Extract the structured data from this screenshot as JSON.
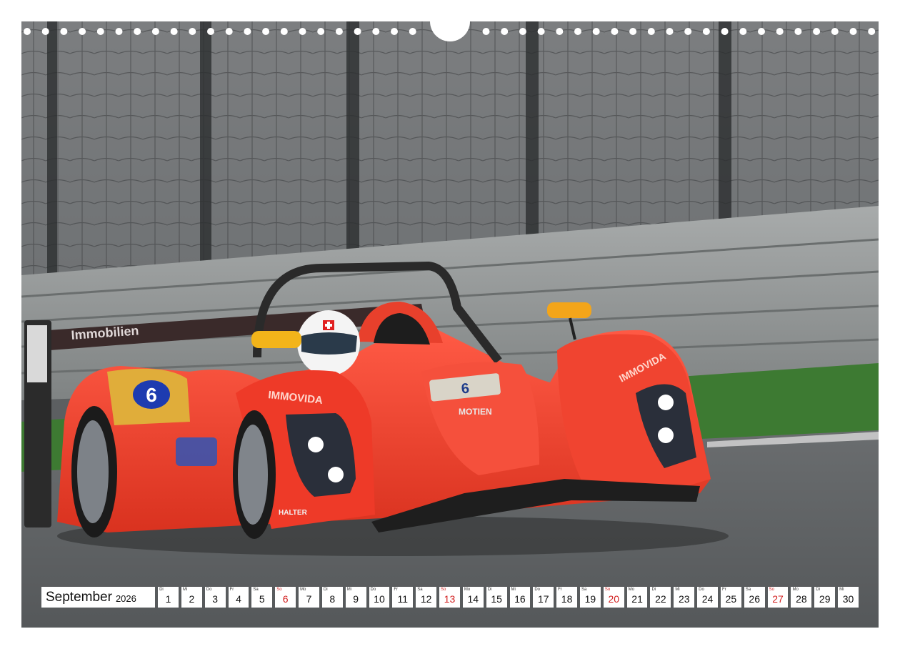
{
  "calendar": {
    "month": "September",
    "year": "2026",
    "days": [
      {
        "wd": "Di",
        "d": "1"
      },
      {
        "wd": "Mi",
        "d": "2"
      },
      {
        "wd": "Do",
        "d": "3"
      },
      {
        "wd": "Fr",
        "d": "4"
      },
      {
        "wd": "Sa",
        "d": "5"
      },
      {
        "wd": "So",
        "d": "6",
        "sun": true
      },
      {
        "wd": "Mo",
        "d": "7"
      },
      {
        "wd": "Di",
        "d": "8"
      },
      {
        "wd": "Mi",
        "d": "9"
      },
      {
        "wd": "Do",
        "d": "10"
      },
      {
        "wd": "Fr",
        "d": "11"
      },
      {
        "wd": "Sa",
        "d": "12"
      },
      {
        "wd": "So",
        "d": "13",
        "sun": true
      },
      {
        "wd": "Mo",
        "d": "14"
      },
      {
        "wd": "Di",
        "d": "15"
      },
      {
        "wd": "Mi",
        "d": "16"
      },
      {
        "wd": "Do",
        "d": "17"
      },
      {
        "wd": "Fr",
        "d": "18"
      },
      {
        "wd": "Sa",
        "d": "19"
      },
      {
        "wd": "So",
        "d": "20",
        "sun": true
      },
      {
        "wd": "Mo",
        "d": "21"
      },
      {
        "wd": "Di",
        "d": "22"
      },
      {
        "wd": "Mi",
        "d": "23"
      },
      {
        "wd": "Do",
        "d": "24"
      },
      {
        "wd": "Fr",
        "d": "25"
      },
      {
        "wd": "Sa",
        "d": "26"
      },
      {
        "wd": "So",
        "d": "27",
        "sun": true
      },
      {
        "wd": "Mo",
        "d": "28"
      },
      {
        "wd": "Di",
        "d": "29"
      },
      {
        "wd": "Mi",
        "d": "30"
      }
    ]
  },
  "car_livery": {
    "number": "6",
    "sidepod_text": "IMMOVIDA",
    "nose_text": "MOTIEN",
    "sponsor_text": "HALTER",
    "fender_text": "IMMOVIDA",
    "wing_text": "Immobilien"
  },
  "colors": {
    "car_red": "#f2412f",
    "weekend_red": "#d21f1f",
    "asphalt": "#5c5f61",
    "grass": "#3d7a32"
  }
}
